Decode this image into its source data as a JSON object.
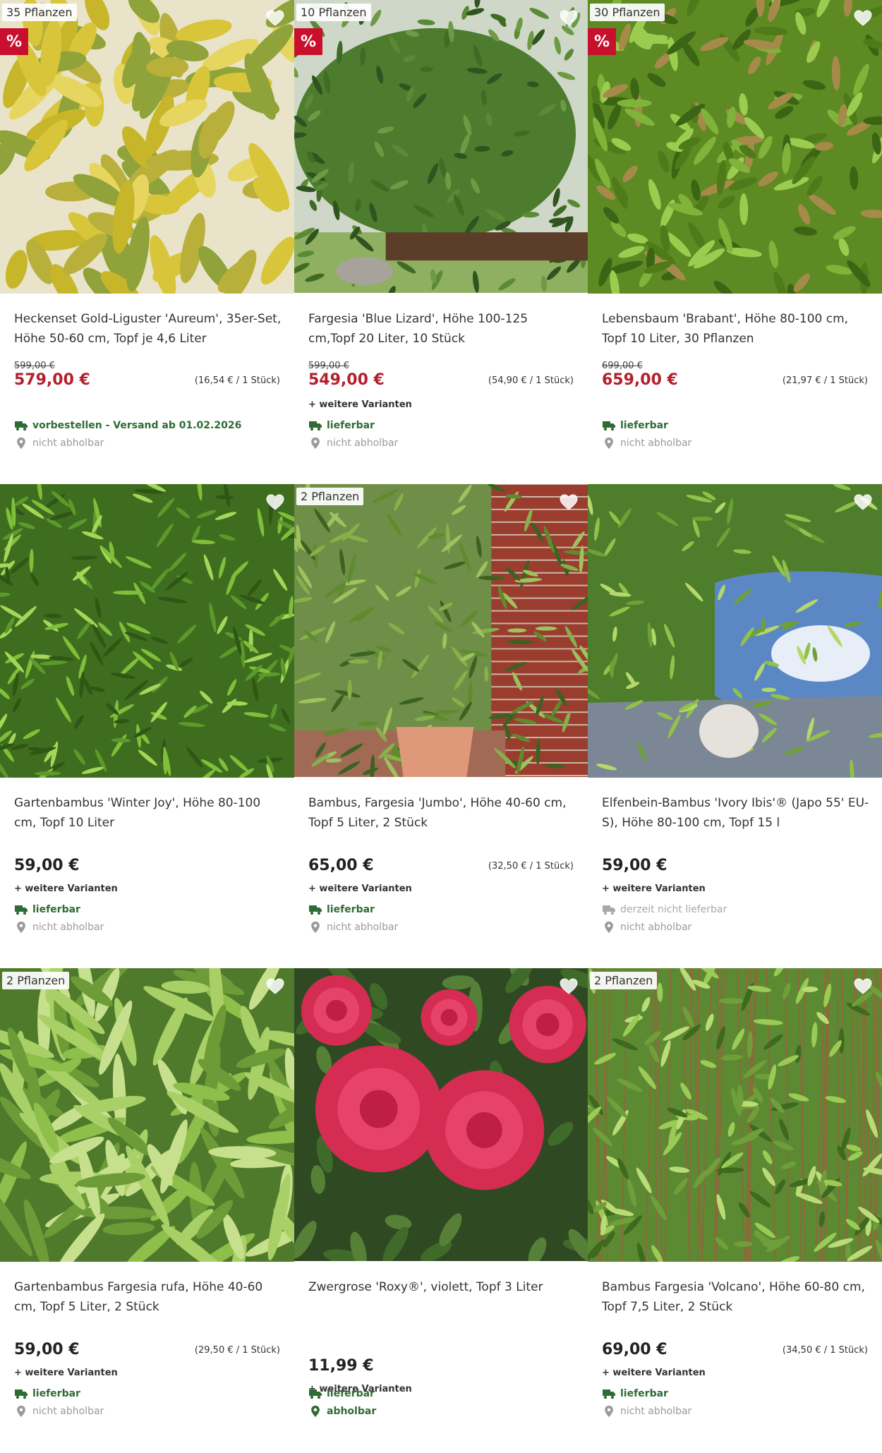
{
  "colors": {
    "sale": "#c8102e",
    "price_sale": "#b3202c",
    "available": "#2f6b35",
    "muted": "#9a9a9a"
  },
  "products": [
    {
      "badge": "35 Pflanzen",
      "sale": true,
      "sale_label": "%",
      "title": "Heckenset Gold-Liguster 'Aureum', 35er-Set, Höhe 50-60 cm, Topf je 4,6 Liter",
      "old_price": "599,00 €",
      "price": "579,00 €",
      "unit_price": "(16,54 € / 1 Stück)",
      "variants": "",
      "delivery": "vorbestellen - Versand ab 01.02.2026",
      "delivery_available": true,
      "pickup": "nicht abholbar",
      "pickup_available": false,
      "scene": "yellow"
    },
    {
      "badge": "10 Pflanzen",
      "sale": true,
      "sale_label": "%",
      "title": "Fargesia 'Blue Lizard', Höhe 100-125 cm,Topf 20 Liter, 10 Stück",
      "old_price": "599,00 €",
      "price": "549,00 €",
      "unit_price": "(54,90 € / 1 Stück)",
      "variants": "+ weitere Varianten",
      "delivery": "lieferbar",
      "delivery_available": true,
      "pickup": "nicht abholbar",
      "pickup_available": false,
      "scene": "hedge"
    },
    {
      "badge": "30 Pflanzen",
      "sale": true,
      "sale_label": "%",
      "title": "Lebensbaum 'Brabant', Höhe 80-100 cm, Topf 10 Liter, 30 Pflanzen",
      "old_price": "699,00 €",
      "price": "659,00 €",
      "unit_price": "(21,97 € / 1 Stück)",
      "variants": "",
      "delivery": "lieferbar",
      "delivery_available": true,
      "pickup": "nicht abholbar",
      "pickup_available": false,
      "scene": "thuja"
    },
    {
      "badge": "",
      "sale": false,
      "sale_label": "",
      "title": "Gartenbambus 'Winter Joy', Höhe 80-100 cm, Topf 10 Liter",
      "old_price": "",
      "price": "59,00 €",
      "unit_price": "",
      "variants": "+ weitere Varianten",
      "delivery": "lieferbar",
      "delivery_available": true,
      "pickup": "nicht abholbar",
      "pickup_available": false,
      "scene": "bamboo"
    },
    {
      "badge": "2 Pflanzen",
      "sale": false,
      "sale_label": "",
      "title": "Bambus, Fargesia 'Jumbo', Höhe 40-60 cm, Topf 5 Liter, 2 Stück",
      "old_price": "",
      "price": "65,00 €",
      "unit_price": "(32,50 € / 1 Stück)",
      "variants": "+ weitere Varianten",
      "delivery": "lieferbar",
      "delivery_available": true,
      "pickup": "nicht abholbar",
      "pickup_available": false,
      "scene": "pot"
    },
    {
      "badge": "",
      "sale": false,
      "sale_label": "",
      "title": "Elfenbein-Bambus 'Ivory Ibis'® (Japo 55' EU-S), Höhe 80-100 cm, Topf 15 l",
      "old_price": "",
      "price": "59,00 €",
      "unit_price": "",
      "variants": "+ weitere Varianten",
      "delivery": "derzeit nicht lieferbar",
      "delivery_available": false,
      "pickup": "nicht abholbar",
      "pickup_available": false,
      "scene": "pond"
    },
    {
      "badge": "2 Pflanzen",
      "sale": false,
      "sale_label": "",
      "title": "Gartenbambus Fargesia rufa, Höhe 40-60 cm, Topf 5 Liter, 2 Stück",
      "old_price": "",
      "price": "59,00 €",
      "unit_price": "(29,50 € / 1 Stück)",
      "variants": "+ weitere Varianten",
      "delivery": "lieferbar",
      "delivery_available": true,
      "pickup": "nicht abholbar",
      "pickup_available": false,
      "scene": "leaves"
    },
    {
      "badge": "",
      "sale": false,
      "sale_label": "",
      "title": "Zwergrose 'Roxy®', violett, Topf 3 Liter",
      "old_price": "",
      "price": "11,99 €",
      "unit_price": "",
      "variants": "+ weitere Varianten",
      "delivery": "lieferbar",
      "delivery_available": true,
      "pickup": "abholbar",
      "pickup_available": true,
      "scene": "rose"
    },
    {
      "badge": "2 Pflanzen",
      "sale": false,
      "sale_label": "",
      "title": "Bambus Fargesia 'Volcano', Höhe 60-80 cm, Topf 7,5 Liter, 2 Stück",
      "old_price": "",
      "price": "69,00 €",
      "unit_price": "(34,50 € / 1 Stück)",
      "variants": "+ weitere Varianten",
      "delivery": "lieferbar",
      "delivery_available": true,
      "pickup": "nicht abholbar",
      "pickup_available": false,
      "scene": "stems"
    }
  ]
}
